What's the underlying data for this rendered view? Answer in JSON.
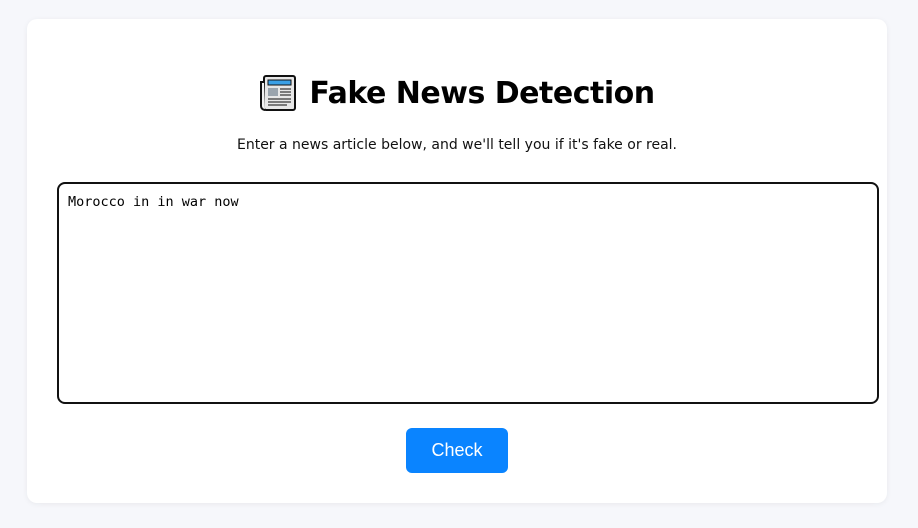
{
  "header": {
    "icon": "newspaper-icon",
    "title": "Fake News Detection",
    "subtitle": "Enter a news article below, and we'll tell you if it's fake or real."
  },
  "input": {
    "value": "Morocco in in war now",
    "placeholder": ""
  },
  "actions": {
    "check_label": "Check"
  },
  "colors": {
    "page_background": "#f6f7fb",
    "card_background": "#ffffff",
    "button": "#0a84ff",
    "button_text": "#ffffff",
    "border": "#111111"
  }
}
